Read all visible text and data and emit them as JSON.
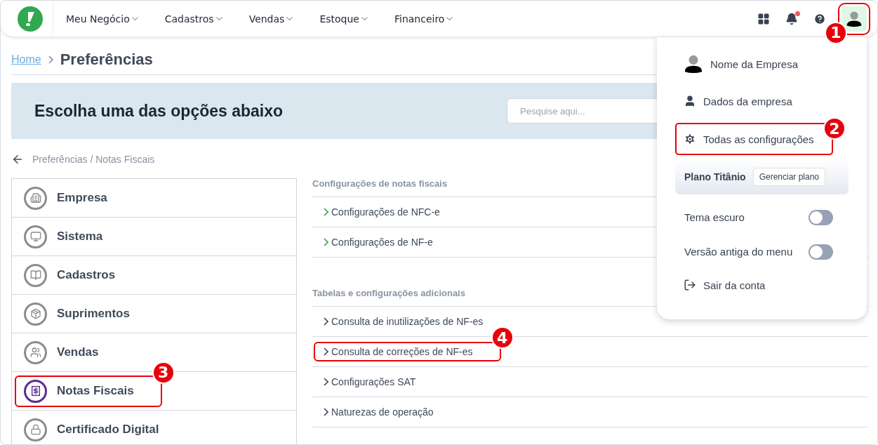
{
  "nav": {
    "items": [
      {
        "label": "Meu Negócio"
      },
      {
        "label": "Cadastros"
      },
      {
        "label": "Vendas"
      },
      {
        "label": "Estoque"
      },
      {
        "label": "Financeiro"
      }
    ],
    "notification": true,
    "avatar_callout": "1"
  },
  "breadcrumb": {
    "home": "Home",
    "current": "Preferências"
  },
  "banner": {
    "title": "Escolha uma das opções abaixo",
    "search": {
      "placeholder": "Pesquise aqui..."
    }
  },
  "back": {
    "path": "Preferências / Notas Fiscais"
  },
  "sidebar": {
    "items": [
      {
        "label": "Empresa",
        "selected": false
      },
      {
        "label": "Sistema",
        "selected": false
      },
      {
        "label": "Cadastros",
        "selected": false
      },
      {
        "label": "Suprimentos",
        "selected": false
      },
      {
        "label": "Vendas",
        "selected": false
      },
      {
        "label": "Notas Fiscais",
        "selected": true,
        "callout": "3"
      },
      {
        "label": "Certificado Digital",
        "selected": false
      }
    ]
  },
  "sections": [
    {
      "title": "Configurações de notas fiscais",
      "links": [
        {
          "label": "Configurações de NFC-e",
          "color": "#2fa84f"
        },
        {
          "label": "Configurações de NF-e",
          "color": "#2fa84f"
        }
      ]
    },
    {
      "title": "Tabelas e configurações adicionais",
      "links": [
        {
          "label": "Consulta de inutilizações de NF-es",
          "color": "#3f4a5a"
        },
        {
          "label": "Consulta de correções de NF-es",
          "color": "#3f4a5a",
          "callout": "4"
        },
        {
          "label": "Configurações SAT",
          "color": "#3f4a5a"
        },
        {
          "label": "Naturezas de operação",
          "color": "#3f4a5a"
        }
      ]
    }
  ],
  "menu": {
    "company": "Nome da Empresa",
    "items": [
      {
        "kind": "profile",
        "label": "Dados da empresa"
      },
      {
        "kind": "settings",
        "label": "Todas as configurações",
        "callout": "2"
      }
    ],
    "plan": {
      "name": "Plano Titânio",
      "button": "Gerenciar plano"
    },
    "toggles": [
      {
        "label": "Tema escuro",
        "on": false
      },
      {
        "label": "Versão antiga do menu",
        "on": false
      }
    ],
    "logout": "Sair da conta"
  }
}
